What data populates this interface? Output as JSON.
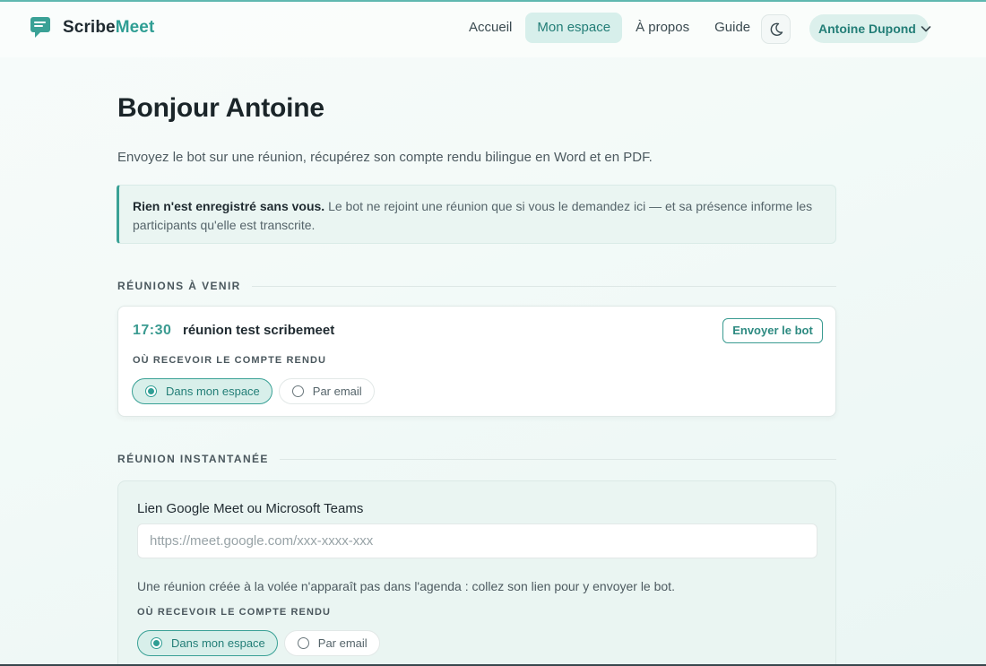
{
  "header": {
    "brand": {
      "part1": "Scribe",
      "part2": "Meet"
    },
    "nav": [
      {
        "label": "Accueil",
        "active": false
      },
      {
        "label": "Mon espace",
        "active": true
      },
      {
        "label": "À propos",
        "active": false
      },
      {
        "label": "Guide",
        "active": false
      }
    ],
    "user": {
      "name": "Antoine Dupond"
    }
  },
  "main": {
    "greeting": "Bonjour Antoine",
    "subtitle": "Envoyez le bot sur une réunion, récupérez son compte rendu bilingue en Word et en PDF.",
    "notice": {
      "strong": "Rien n'est enregistré sans vous.",
      "text": " Le bot ne rejoint une réunion que si vous le demandez ici — et sa présence informe les participants qu'elle est transcrite."
    },
    "upcoming": {
      "section_title": "RÉUNIONS À VENIR",
      "meeting": {
        "time": "17:30",
        "title": "réunion test scribemeet",
        "send_label": "Envoyer le bot",
        "delivery_title": "OÙ RECEVOIR LE COMPTE RENDU",
        "options": [
          {
            "label": "Dans mon espace",
            "selected": true
          },
          {
            "label": "Par email",
            "selected": false
          }
        ]
      }
    },
    "instant": {
      "section_title": "RÉUNION INSTANTANÉE",
      "field_label": "Lien Google Meet ou Microsoft Teams",
      "placeholder": "https://meet.google.com/xxx-xxxx-xxx",
      "value": "",
      "help": "Une réunion créée à la volée n'apparaît pas dans l'agenda : collez son lien pour y envoyer le bot.",
      "delivery_title": "OÙ RECEVOIR LE COMPTE RENDU",
      "options": [
        {
          "label": "Dans mon espace",
          "selected": true
        },
        {
          "label": "Par email",
          "selected": false
        }
      ]
    }
  },
  "colors": {
    "accent": "#2f9e94",
    "accent_light": "#d8efea",
    "text": "#1f2a30",
    "notice_bg": "#eaf5f2"
  },
  "icons": [
    "chat-bubble-icon",
    "moon-icon",
    "chevron-down-icon"
  ]
}
